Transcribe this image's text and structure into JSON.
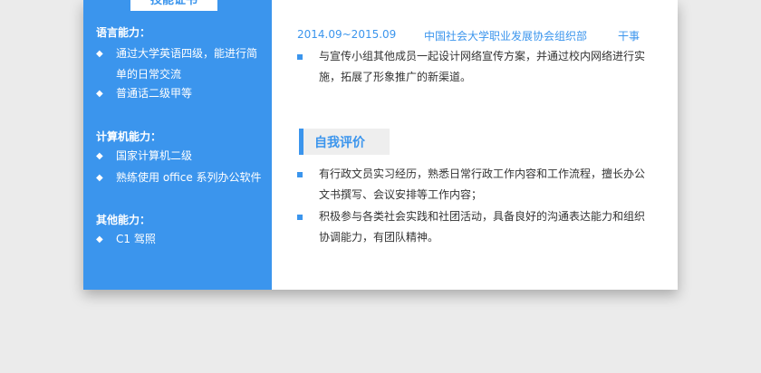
{
  "sidebar": {
    "section_tab": "技能证书",
    "language": {
      "title": "语言能力：",
      "items": [
        "通过大学英语四级，能进行简单的日常交流",
        "普通话二级甲等"
      ]
    },
    "computer": {
      "title": "计算机能力：",
      "items": [
        "国家计算机二级",
        "熟练使用 office 系列办公软件"
      ]
    },
    "other": {
      "title": "其他能力：",
      "items": [
        "C1 驾照"
      ]
    },
    "bullet_glyph": "◆"
  },
  "experience": {
    "date": "2014.09~2015.09",
    "org": "中国社会大学职业发展协会组织部",
    "role": "干事",
    "bullets": [
      "与宣传小组其他成员一起设计网络宣传方案，并通过校内网络进行实施，拓展了形象推广的新渠道。"
    ]
  },
  "self_eval": {
    "title": "自我评价",
    "bullets": [
      "有行政文员实习经历，熟悉日常行政工作内容和工作流程，擅长办公文书撰写、会议安排等工作内容；",
      "积极参与各类社会实践和社团活动，具备良好的沟通表达能力和组织协调能力，有团队精神。"
    ]
  },
  "colors": {
    "accent": "#3b95ed",
    "background": "#ebebeb",
    "text": "#333333"
  }
}
